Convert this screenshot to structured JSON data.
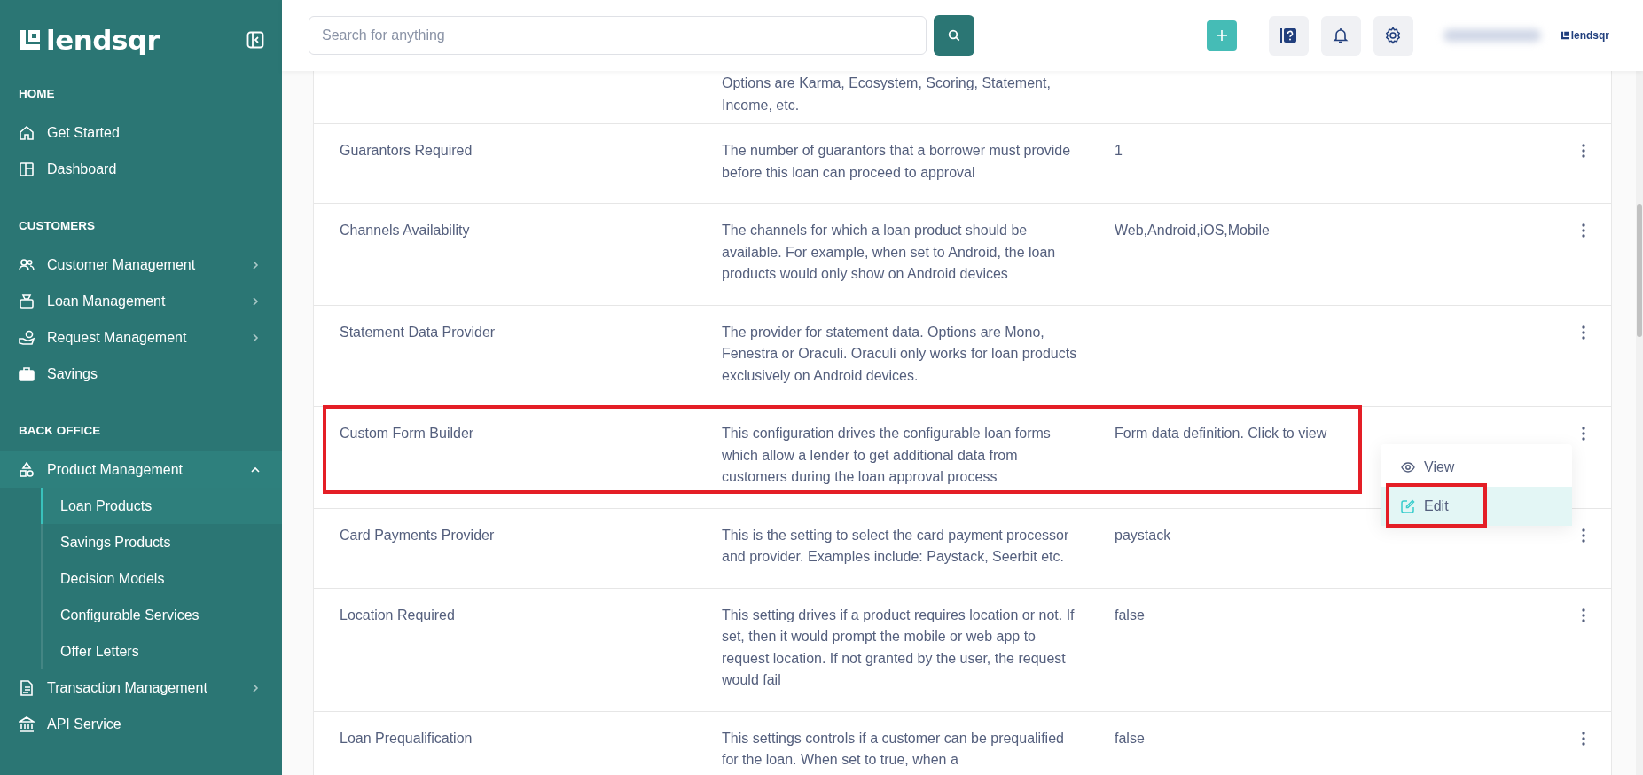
{
  "sidebar": {
    "logo": "lendsqr",
    "sections": [
      {
        "title": "HOME",
        "items": [
          {
            "label": "Get Started",
            "kind": "link"
          },
          {
            "label": "Dashboard",
            "kind": "link"
          }
        ]
      },
      {
        "title": "CUSTOMERS",
        "items": [
          {
            "label": "Customer Management",
            "kind": "group",
            "expanded": false
          },
          {
            "label": "Loan Management",
            "kind": "group",
            "expanded": false
          },
          {
            "label": "Request Management",
            "kind": "group",
            "expanded": false
          },
          {
            "label": "Savings",
            "kind": "link"
          }
        ]
      },
      {
        "title": "BACK OFFICE",
        "items": [
          {
            "label": "Product Management",
            "kind": "group",
            "expanded": true,
            "children": [
              {
                "label": "Loan Products",
                "selected": true
              },
              {
                "label": "Savings Products",
                "selected": false
              },
              {
                "label": "Decision Models",
                "selected": false
              },
              {
                "label": "Configurable Services",
                "selected": false
              },
              {
                "label": "Offer Letters",
                "selected": false
              }
            ]
          },
          {
            "label": "Transaction Management",
            "kind": "group",
            "expanded": false
          },
          {
            "label": "API Service",
            "kind": "link"
          }
        ]
      }
    ]
  },
  "header": {
    "search": {
      "placeholder": "Search for anything"
    },
    "brand": "lendsqr"
  },
  "table": {
    "rows": [
      {
        "name": "",
        "description": "Options are Karma, Ecosystem, Scoring, Statement, Income, etc.",
        "value": "",
        "partial": true,
        "highlighted": false
      },
      {
        "name": "Guarantors Required",
        "description": "The number of guarantors that a borrower must provide before this loan can proceed to approval",
        "value": "1",
        "highlighted": false
      },
      {
        "name": "Channels Availability",
        "description": "The channels for which a loan product should be available. For example, when set to Android, the loan products would only show on Android devices",
        "value": "Web,Android,iOS,Mobile",
        "highlighted": false
      },
      {
        "name": "Statement Data Provider",
        "description": "The provider for statement data. Options are Mono, Fenestra or Oraculi. Oraculi only works for loan products exclusively on Android devices.",
        "value": "",
        "highlighted": false
      },
      {
        "name": "Custom Form Builder",
        "description": "This configuration drives the configurable loan forms which allow a lender to get additional data from customers during the loan approval process",
        "value": "Form data definition. Click to view",
        "highlighted": true,
        "menu": [
          {
            "label": "View",
            "selected": false,
            "highlighted": false
          },
          {
            "label": "Edit",
            "selected": true,
            "highlighted": true
          }
        ]
      },
      {
        "name": "Card Payments Provider",
        "description": "This is the setting to select the card payment processor and provider. Examples include: Paystack, Seerbit etc.",
        "value": "paystack",
        "highlighted": false
      },
      {
        "name": "Location Required",
        "description": "This setting drives if a product requires location or not. If set, then it would prompt the mobile or web app to request location. If not granted by the user, the request would fail",
        "value": "false",
        "highlighted": false
      },
      {
        "name": "Loan Prequalification",
        "description": "This settings controls if a customer can be prequalified for the loan. When set to true, when a",
        "value": "false",
        "highlighted": false
      }
    ]
  }
}
